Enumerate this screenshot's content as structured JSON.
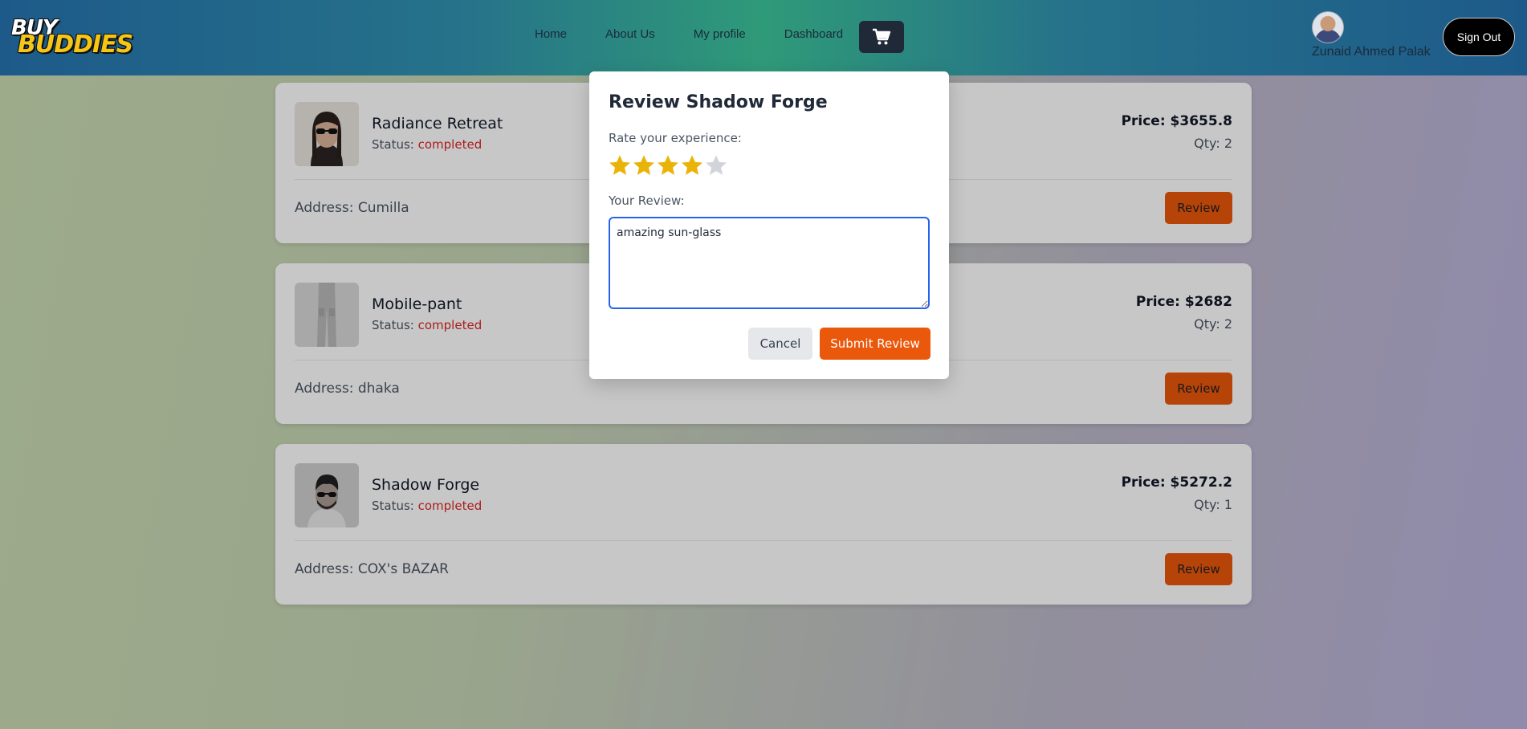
{
  "brand": {
    "logo_top": "BUY",
    "logo_bottom": "BUDDIES"
  },
  "nav": {
    "links": [
      "Home",
      "About Us",
      "My profile",
      "Dashboard"
    ],
    "cart_icon": "shopping-cart-icon"
  },
  "user": {
    "name": "Zunaid Ahmed Palak",
    "signout_label": "Sign Out"
  },
  "orders": [
    {
      "title": "Radiance Retreat",
      "status_label": "Status: ",
      "status": "completed",
      "price": "Price: $3655.8",
      "qty": "Qty: 2",
      "address": "Address: Cumilla",
      "review_label": "Review",
      "thumb": "woman-sunglasses"
    },
    {
      "title": "Mobile-pant",
      "status_label": "Status: ",
      "status": "completed",
      "price": "Price: $2682",
      "qty": "Qty: 2",
      "address": "Address: dhaka",
      "review_label": "Review",
      "thumb": "grey-cargo-pants"
    },
    {
      "title": "Shadow Forge",
      "status_label": "Status: ",
      "status": "completed",
      "price": "Price: $5272.2",
      "qty": "Qty: 1",
      "address": "Address: COX's BAZAR",
      "review_label": "Review",
      "thumb": "man-sunglasses"
    }
  ],
  "modal": {
    "title": "Review Shadow Forge",
    "rate_label": "Rate your experience:",
    "rating": 4,
    "rating_max": 5,
    "review_label": "Your Review:",
    "review_text": "amazing sun-glass",
    "cancel_label": "Cancel",
    "submit_label": "Submit Review"
  },
  "colors": {
    "accent": "#ea580c",
    "status": "#dc2626",
    "star_filled": "#eab308",
    "star_empty": "#d1d5db"
  }
}
